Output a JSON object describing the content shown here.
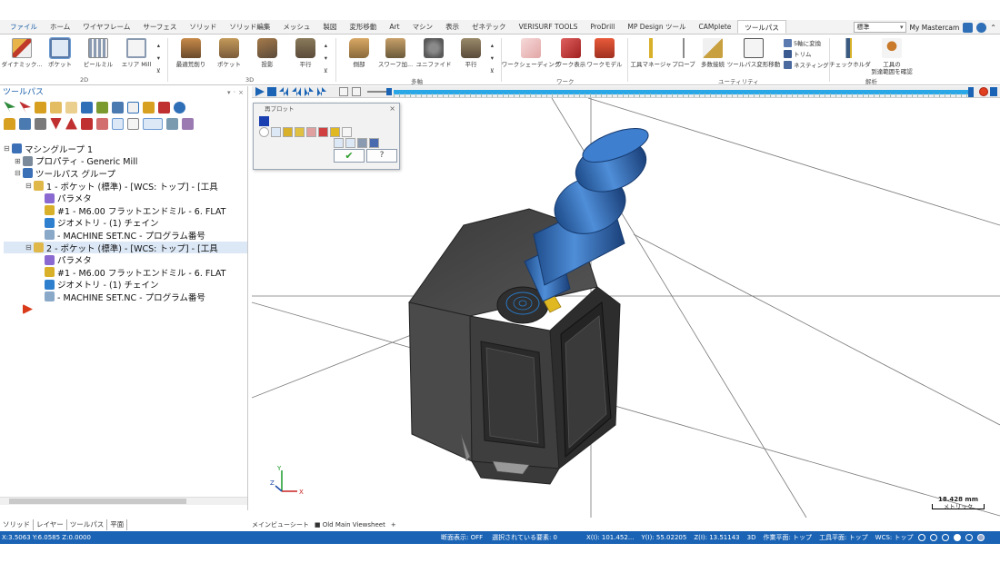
{
  "ribbon_tabs": [
    {
      "label": "ファイル",
      "kind": "file"
    },
    {
      "label": "ホーム"
    },
    {
      "label": "ワイヤフレーム"
    },
    {
      "label": "サーフェス"
    },
    {
      "label": "ソリッド"
    },
    {
      "label": "ソリッド編集"
    },
    {
      "label": "メッシュ"
    },
    {
      "label": "製図"
    },
    {
      "label": "変形移動"
    },
    {
      "label": "Art"
    },
    {
      "label": "マシン"
    },
    {
      "label": "表示"
    },
    {
      "label": "ゼネテック"
    },
    {
      "label": "VERISURF TOOLS"
    },
    {
      "label": "ProDrill"
    },
    {
      "label": "MP Design ツール"
    },
    {
      "label": "CAMplete"
    },
    {
      "label": "ツールパス",
      "kind": "active"
    }
  ],
  "tabs_right": {
    "combo_value": "標準",
    "my_mastercam": "My Mastercam"
  },
  "ribbon": {
    "dynamic": "ダイナミック...",
    "pocket": "ポケット",
    "peel_mill": "ピールミル",
    "area_mill": "エリア Mill",
    "group_2d": "2D",
    "optimized_rough": "最適荒削り",
    "pocket_3d": "ポケット",
    "projection": "投影",
    "parallel": "平行",
    "group_3d": "3D",
    "side_wall": "側部",
    "swarf": "スワーフ加...",
    "unified": "ユニファイド",
    "parallel_multi": "平行",
    "group_multi": "多軸",
    "work_shading": "ワークシェーディング",
    "work_display": "ワーク表示",
    "work_model": "ワークモデル",
    "group_work": "ワーク",
    "tool_manager": "工具マネージャ",
    "probe": "プローブ",
    "multi_link": "多数接続",
    "toolpath_transform": "ツールパス変形移動",
    "convert_5axis": "5軸に変換",
    "trim": "トリム",
    "nesting": "ネスティング",
    "group_utility": "ユーティリティ",
    "check_holder": "チェックホルダ",
    "tool_reach": "工具の\n到達範囲を確認",
    "group_analysis": "解析"
  },
  "panel": {
    "title": "ツールパス",
    "controls": "▾ ᛫ ×"
  },
  "tree": [
    {
      "text": "マシングループ 1",
      "indent": 0,
      "exp": "⊟",
      "icon": "machine-group-icon",
      "color": "#3b6fb6"
    },
    {
      "text": "プロパティ - Generic Mill",
      "indent": 1,
      "exp": "⊞",
      "icon": "properties-icon",
      "color": "#7a8a9a"
    },
    {
      "text": "ツールパス グループ",
      "indent": 1,
      "exp": "⊟",
      "icon": "toolpath-group-icon",
      "color": "#3b6fb6"
    },
    {
      "text": "1 - ポケット (標準) - [WCS: トップ] - [工具",
      "indent": 2,
      "exp": "⊟",
      "icon": "folder-icon",
      "color": "#e0b84a"
    },
    {
      "text": "パラメタ",
      "indent": 3,
      "exp": "",
      "icon": "parameters-icon",
      "color": "#8a6ad0"
    },
    {
      "text": "#1 - M6.00 フラットエンドミル - 6. FLAT",
      "indent": 3,
      "exp": "",
      "icon": "tool-icon",
      "color": "#d8b02a"
    },
    {
      "text": "ジオメトリ - (1) チェイン",
      "indent": 3,
      "exp": "",
      "icon": "geometry-icon",
      "color": "#2f7fcf"
    },
    {
      "text": " - MACHINE SET.NC - プログラム番号",
      "indent": 3,
      "exp": "",
      "icon": "nc-file-icon",
      "color": "#8aa8c8"
    },
    {
      "text": "2 - ポケット (標準) - [WCS: トップ] - [工具",
      "indent": 2,
      "exp": "⊟",
      "icon": "folder-icon",
      "color": "#e0b84a",
      "hl": true
    },
    {
      "text": "パラメタ",
      "indent": 3,
      "exp": "",
      "icon": "parameters-icon",
      "color": "#8a6ad0"
    },
    {
      "text": "#1 - M6.00 フラットエンドミル - 6. FLAT",
      "indent": 3,
      "exp": "",
      "icon": "tool-icon",
      "color": "#d8b02a"
    },
    {
      "text": "ジオメトリ - (1) チェイン",
      "indent": 3,
      "exp": "",
      "icon": "geometry-icon",
      "color": "#2f7fcf"
    },
    {
      "text": " - MACHINE SET.NC - プログラム番号",
      "indent": 3,
      "exp": "",
      "icon": "nc-file-icon",
      "color": "#8aa8c8"
    },
    {
      "text": "",
      "indent": 1,
      "exp": "",
      "icon": "insert-arrow-icon",
      "color": "#d83a1a"
    }
  ],
  "replot": {
    "title": "再プロット"
  },
  "left_tabs": [
    "ソリッド",
    "レイヤー",
    "ツールパス",
    "平面"
  ],
  "view_tabs": {
    "main": "メインビューシート",
    "old": "Old Main Viewsheet",
    "add": "+"
  },
  "scale": {
    "value": "18.428 mm",
    "unit": "メトリック"
  },
  "status": {
    "left": "X:3.5063  Y:6.0585  Z:0.0000",
    "section": "断面表示: OFF",
    "selected": "選択されている要素: 0",
    "x": "X(I):  101.452...",
    "y": "Y(I):  55.02205",
    "z": "Z(I):  13.51143",
    "mode": "3D",
    "work_plane": "作業平面: トップ",
    "tool_plane": "工具平面: トップ",
    "wcs": "WCS: トップ"
  },
  "colors": {
    "accent": "#1b64b5",
    "sim_track": "#2aa7e6",
    "part": "#4a4a4a"
  }
}
